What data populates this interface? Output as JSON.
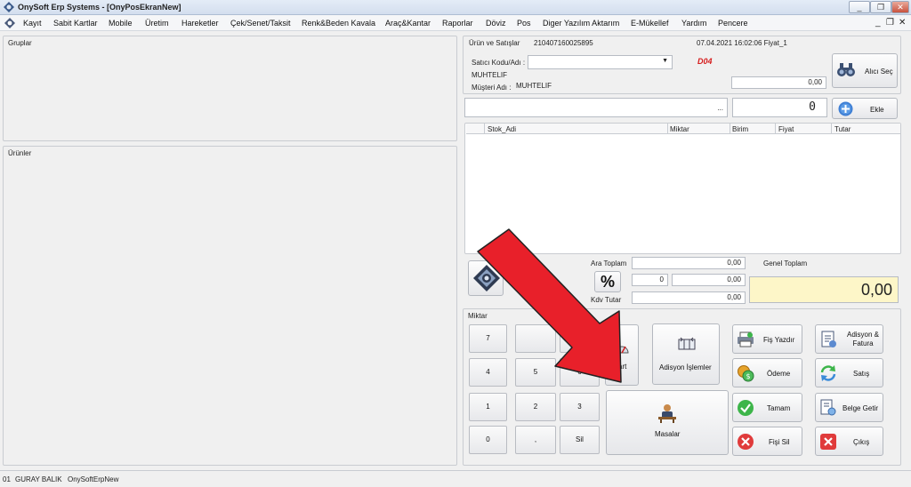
{
  "window": {
    "title": "OnySoft Erp Systems - [OnyPosEkranNew]",
    "minimize": "_",
    "restore": "❐",
    "close": "✕"
  },
  "menu": {
    "items": [
      "Kayıt",
      "Sabit Kartlar",
      "Mobile",
      "Üretim",
      "Hareketler",
      "Çek/Senet/Taksit",
      "Renk&Beden Kavala",
      "Araç&Kantar",
      "Raporlar",
      "Döviz",
      "Pos",
      "Diger Yazılım Aktarım",
      "E-Mükellef",
      "Yardım",
      "Pencere"
    ],
    "mdi_minimize": "_",
    "mdi_restore": "❐",
    "mdi_close": "✕"
  },
  "left": {
    "groups_title": "Gruplar",
    "products_title": "Ürünler"
  },
  "sale": {
    "header_label": "Ürün ve Satışlar",
    "receipt_no": "210407160025895",
    "datetime": "07.04.2021 16:02:06 Fiyat_1",
    "seller_label": "Satıcı Kodu/Adı :",
    "seller_value": "",
    "seller_name": "MUHTELIF",
    "customer_label": "Müşteri Adı :",
    "customer_value": "MUHTELIF",
    "code": "D04",
    "customer_balance": "0,00",
    "buyer_button": "Alıcı Seç",
    "item_input": "",
    "item_input_dots": "...",
    "quantity_value": "0",
    "add_button": "Ekle"
  },
  "grid": {
    "columns": [
      "Stok_Adi",
      "Miktar",
      "Birim",
      "Fiyat",
      "Tutar"
    ],
    "rows": []
  },
  "totals": {
    "subtotal_label": "Ara Toplam",
    "subtotal_value": "0,00",
    "discount_pct": "0",
    "discount_value": "0,00",
    "vat_label": "Kdv Tutar",
    "vat_value": "0,00",
    "grand_label": "Genel Toplam",
    "grand_value": "0,00",
    "percent_symbol": "%"
  },
  "keypad": {
    "title": "Miktar",
    "keys": [
      "7",
      "4",
      "5",
      "6",
      "1",
      "2",
      "3",
      "0",
      ",",
      "Sil"
    ]
  },
  "actions": {
    "tart": "Tart",
    "adisyon_islemler": "Adisyon İşlemler",
    "masalar": "Masalar",
    "fis_yazdir": "Fiş Yazdır",
    "adisyon_fatura": "Adisyon & Fatura",
    "odeme": "Ödeme",
    "satis": "Satış",
    "tamam": "Tamam",
    "belge_getir": "Belge Getir",
    "fisi_sil": "Fişi Sil",
    "cikis": "Çıkış"
  },
  "status": {
    "code": "01",
    "user": "GURAY BALIK",
    "database": "OnySoftErpNew"
  },
  "colors": {
    "accent_red": "#e8202a",
    "grand_total_bg": "#fdf6c8",
    "code_color": "#d61c1c"
  }
}
